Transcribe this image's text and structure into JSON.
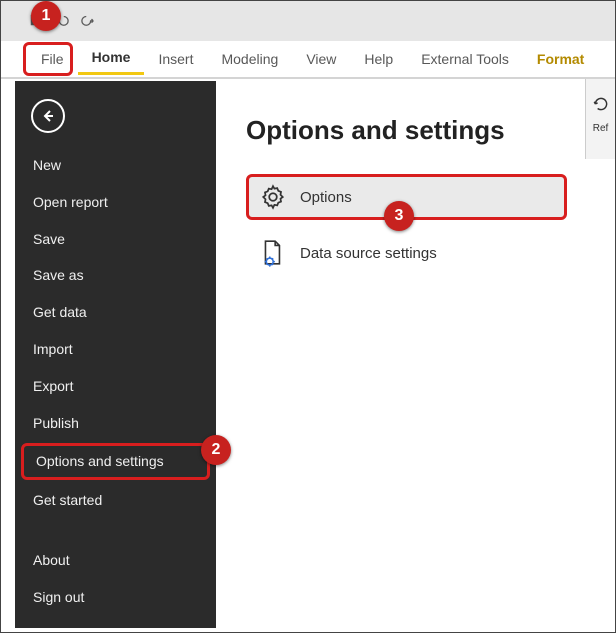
{
  "titlebar": {
    "redo_tooltip": "Redo"
  },
  "ribbon": {
    "tabs": {
      "file": "File",
      "home": "Home",
      "insert": "Insert",
      "modeling": "Modeling",
      "view": "View",
      "help": "Help",
      "external_tools": "External Tools",
      "format": "Format"
    }
  },
  "right_strip": {
    "label": "Ref"
  },
  "file_menu": {
    "items": [
      "New",
      "Open report",
      "Save",
      "Save as",
      "Get data",
      "Import",
      "Export",
      "Publish",
      "Options and settings",
      "Get started"
    ],
    "bottom": [
      "About",
      "Sign out"
    ]
  },
  "content": {
    "heading": "Options and settings",
    "options_label": "Options",
    "data_source_label": "Data source settings"
  },
  "callouts": {
    "c1": "1",
    "c2": "2",
    "c3": "3"
  }
}
